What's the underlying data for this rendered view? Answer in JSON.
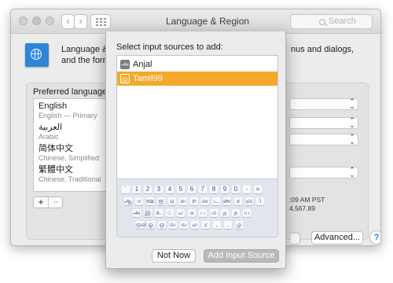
{
  "window": {
    "title": "Language & Region",
    "search_placeholder": "Search"
  },
  "toolbar": {
    "back_glyph": "‹",
    "forward_glyph": "›"
  },
  "description": {
    "line1_left": "Language & R",
    "line2_left": "and the forma",
    "line1_right": "nus and dialogs,"
  },
  "preferred": {
    "label": "Preferred languages:",
    "items": [
      {
        "name": "English",
        "sub": "English — Primary"
      },
      {
        "name": "العربية",
        "sub": "Arabic"
      },
      {
        "name": "简体中文",
        "sub": "Chinese, Simplified"
      },
      {
        "name": "繁體中文",
        "sub": "Chinese, Traditional"
      }
    ],
    "add_label": "+",
    "remove_label": "−"
  },
  "clock_preview": {
    "time": ":09 AM PST",
    "number": "4,567.89"
  },
  "buttons": {
    "advanced": "Advanced...",
    "help": "?"
  },
  "sheet": {
    "title": "Select input sources to add:",
    "sources": [
      {
        "icon": "அ",
        "label": "Anjal",
        "selected": false
      },
      {
        "icon": "இ",
        "label": "Tamil99",
        "selected": true
      }
    ],
    "keyboard_rows": [
      [
        "`",
        "1",
        "2",
        "3",
        "4",
        "5",
        "6",
        "7",
        "8",
        "9",
        "0",
        "-",
        "="
      ],
      [
        "ஆ",
        "ஈ",
        "ஊ",
        "ஐ",
        "ஏ",
        "ள",
        "ற",
        "ன",
        "ட",
        "ண",
        "ச",
        "ஞ",
        "\\"
      ],
      [
        "அ",
        "இ",
        "உ",
        "்",
        "எ",
        "க",
        "ப",
        "ம",
        "த",
        "ந",
        "ய"
      ],
      [
        "ஔ",
        "ஓ",
        "ஒ",
        "வ",
        "ங",
        "ல",
        "ர",
        ",",
        ".",
        "ழ"
      ]
    ],
    "not_now": "Not Now",
    "add": "Add Input Source"
  },
  "colors": {
    "selection": "#f4a82c",
    "accent": "#3478f6",
    "key_text": "#2d4e9f"
  }
}
